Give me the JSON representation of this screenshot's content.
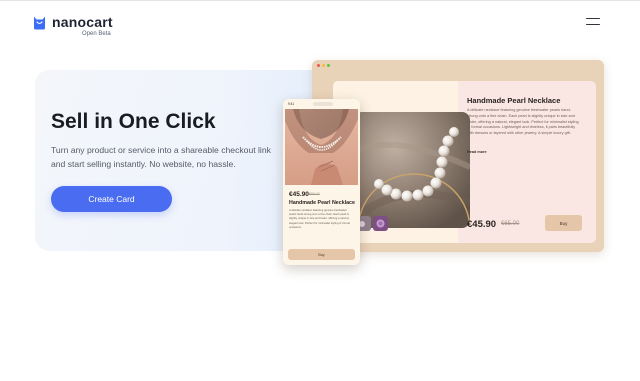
{
  "header": {
    "brand": "nanocart",
    "badge": "Open Beta"
  },
  "hero": {
    "title": "Sell in One Click",
    "subtitle": "Turn any product or service into a shareable checkout link and start selling instantly. No website, no hassle.",
    "cta_label": "Create Card"
  },
  "preview": {
    "product_title": "Handmade Pearl Necklace",
    "description": "A delicate necklace featuring genuine freshwater pearls hand-strung onto a fine chain. Each pearl is slightly unique in size and luster, offering a natural, elegant look. Perfect for minimalist styling or formal occasions. Lightweight and timeless, it pairs beautifully with dresses or layered with other jewelry. A simple luxury gift.",
    "read_more": "Read more",
    "price": "€45.90",
    "old_price": "€65.00",
    "buy_label": "Buy",
    "mobile_time": "9:41",
    "mobile_description": "A delicate necklace featuring genuine freshwater pearls hand-strung onto a fine chain. Each pearl is slightly unique in size and luster, offering a natural, elegant look. Perfect for minimalist styling or formal occasions."
  },
  "colors": {
    "accent": "#4a6cf0",
    "brand_icon": "#3b6ef5",
    "mockup_frame": "#e8d2b8",
    "buy_button": "#e5c6a8",
    "card_panel": "#fae6e2"
  },
  "icons": {
    "logo": "shopping-bag-icon",
    "menu": "hamburger-menu-icon"
  }
}
